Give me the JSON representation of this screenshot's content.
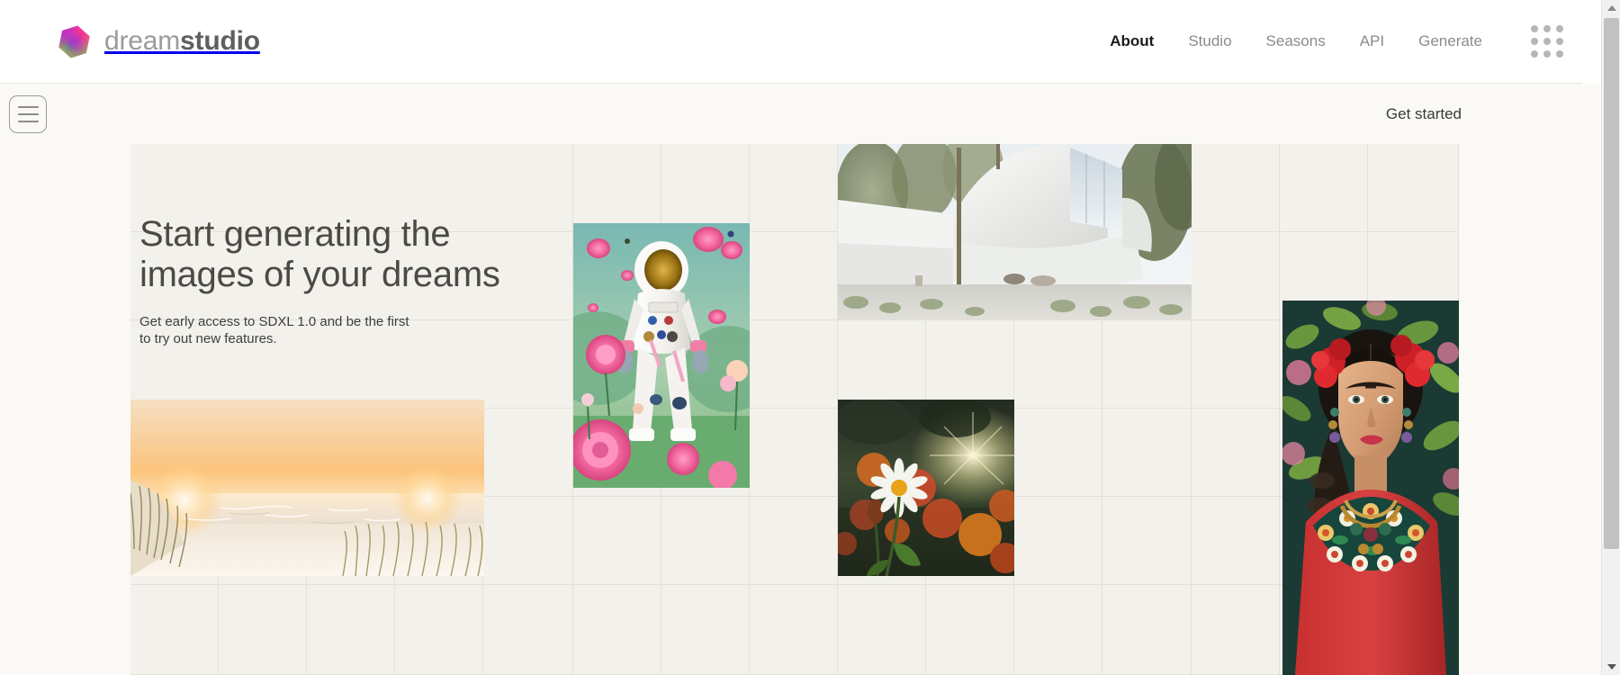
{
  "brand": {
    "logo_icon": "hexagon-gradient-logo",
    "name_light": "dream",
    "name_dark": "studio",
    "gradient_colors": [
      "#ff2d87",
      "#b42ec8",
      "#7d3fd4",
      "#3fae6a",
      "#b9d142",
      "#ff5fa2"
    ]
  },
  "topnav": {
    "items": [
      {
        "label": "About",
        "active": true
      },
      {
        "label": "Studio",
        "active": false
      },
      {
        "label": "Seasons",
        "active": false
      },
      {
        "label": "API",
        "active": false
      },
      {
        "label": "Generate",
        "active": false
      }
    ],
    "apps_grid_icon": "apps-grid-icon"
  },
  "subbar": {
    "menu_icon": "hamburger-menu-icon",
    "get_started_label": "Get started"
  },
  "hero": {
    "heading_line1": "Start generating the",
    "heading_line2": "images of your dreams",
    "subtext_line1": "Get early access to SDXL 1.0 and be the first",
    "subtext_line2": "to try out new features."
  },
  "gallery": {
    "tiles": [
      {
        "name": "architecture-white-pavilion",
        "alt": "Modern white curved architecture pavilion with trees"
      },
      {
        "name": "astronaut-in-roses",
        "alt": "Astronaut in white suit with pink roses and teal sky"
      },
      {
        "name": "beach-dune-sunset",
        "alt": "Sunset over beach with dune grass"
      },
      {
        "name": "daisy-meadow-sunlight",
        "alt": "White daisy in meadow with orange flowers at sunset"
      },
      {
        "name": "frida-portrait",
        "alt": "Portrait of a woman with red flowers in hair and embroidered blouse"
      }
    ]
  },
  "colors": {
    "page_background": "#faf9f5",
    "grid_cell": "#f2f1ec",
    "grid_line": "#e2e0d8",
    "nav_active": "#1c1c1c",
    "nav_inactive": "#8b8b8b"
  },
  "scrollbar": {
    "name": "vertical-scrollbar",
    "up_arrow": "scroll-up-arrow",
    "down_arrow": "scroll-down-arrow"
  }
}
